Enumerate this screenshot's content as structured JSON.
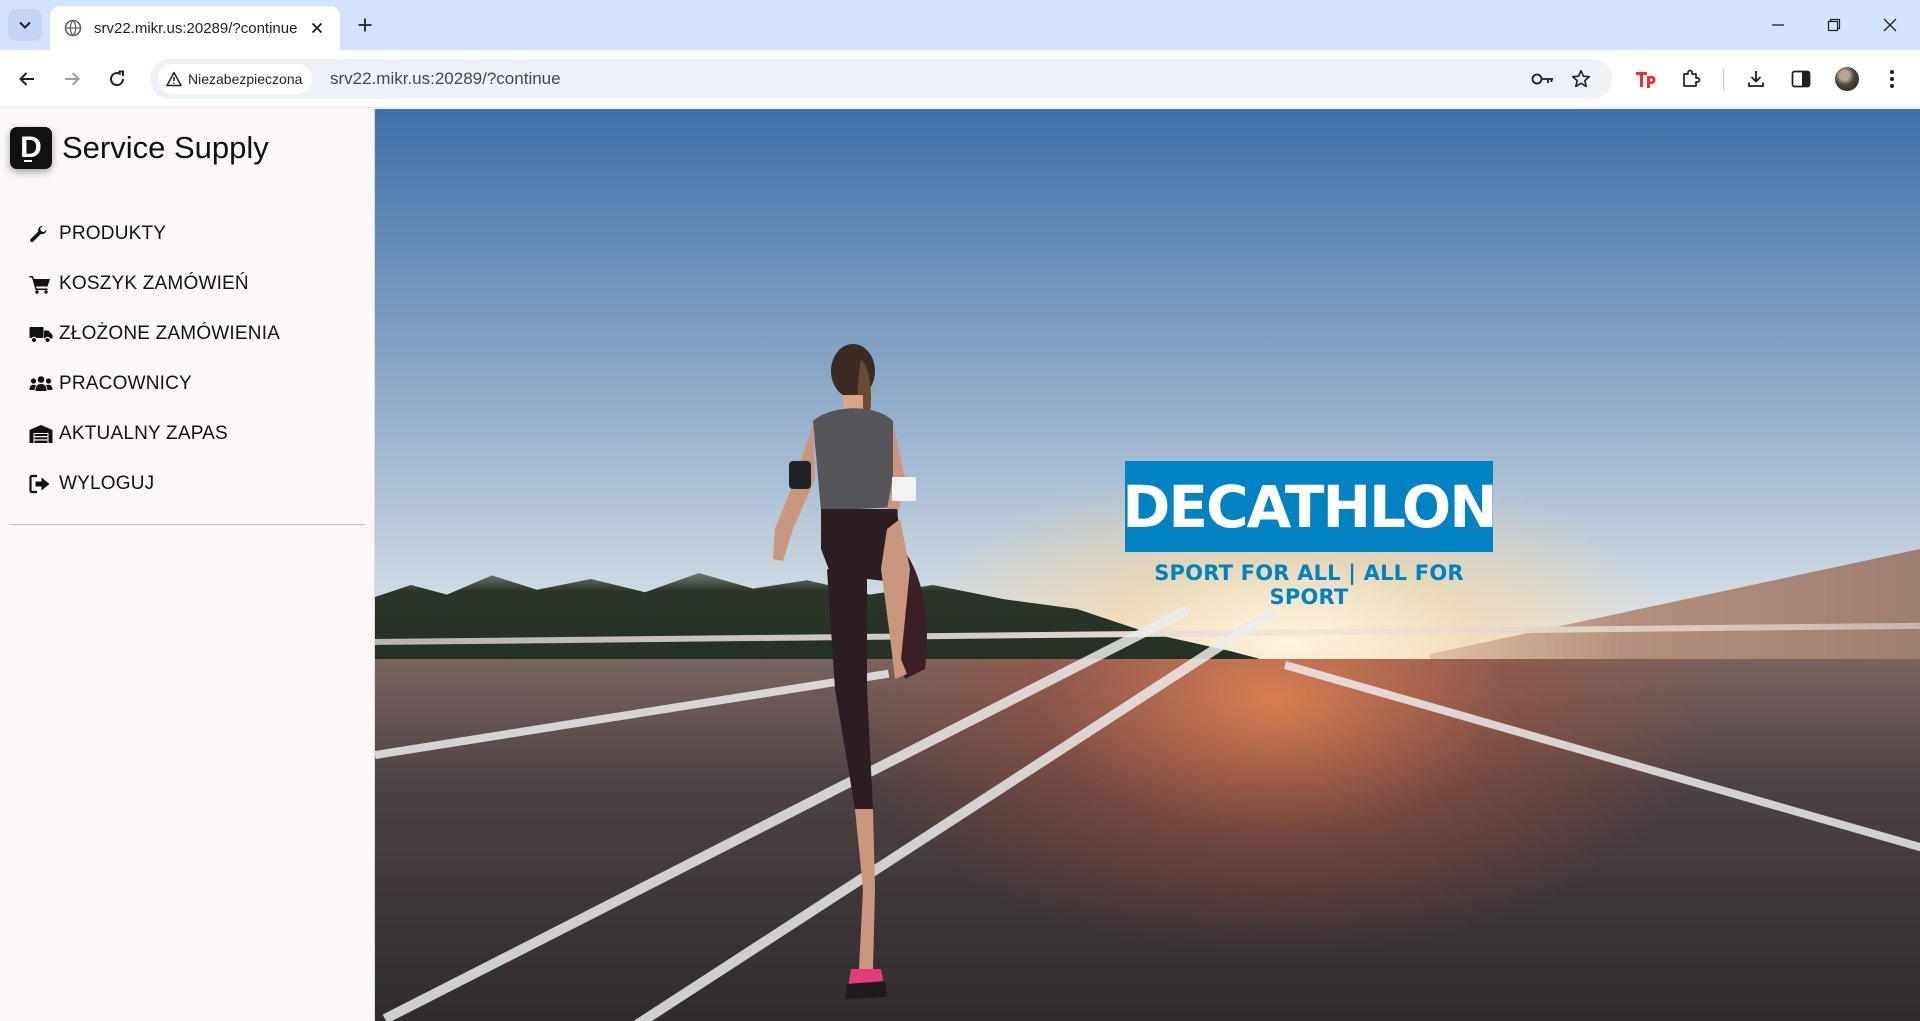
{
  "browser": {
    "tab": {
      "title": "srv22.mikr.us:20289/?continue"
    },
    "address_bar": {
      "security_label": "Niezabezpieczona",
      "url": "srv22.mikr.us:20289/?continue"
    },
    "icons": [
      "tab-search-icon",
      "globe-icon",
      "close-icon",
      "new-tab-icon",
      "minimize-icon",
      "restore-icon",
      "close-window-icon",
      "back-icon",
      "forward-icon",
      "reload-icon",
      "warning-icon",
      "key-icon",
      "star-icon",
      "tp-extension-icon",
      "extensions-icon",
      "download-icon",
      "side-panel-icon",
      "profile-avatar",
      "more-icon"
    ]
  },
  "app": {
    "brand": {
      "logo_letter": "D",
      "name": "Service Supply"
    },
    "menu": [
      {
        "label": "PRODUKTY",
        "icon": "wrench-icon"
      },
      {
        "label": "KOSZYK ZAMÓWIEŃ",
        "icon": "cart-icon"
      },
      {
        "label": "ZŁOŻONE ZAMÓWIENIA",
        "icon": "truck-icon"
      },
      {
        "label": "PRACOWNICY",
        "icon": "users-icon"
      },
      {
        "label": "AKTUALNY ZAPAS",
        "icon": "warehouse-icon"
      },
      {
        "label": "WYLOGUJ",
        "icon": "sign-out-icon"
      }
    ]
  },
  "hero": {
    "logo_text": "DECATHLON",
    "slogan": "SPORT FOR ALL | ALL FOR SPORT",
    "colors": {
      "brand_blue": "#0082c3"
    }
  }
}
